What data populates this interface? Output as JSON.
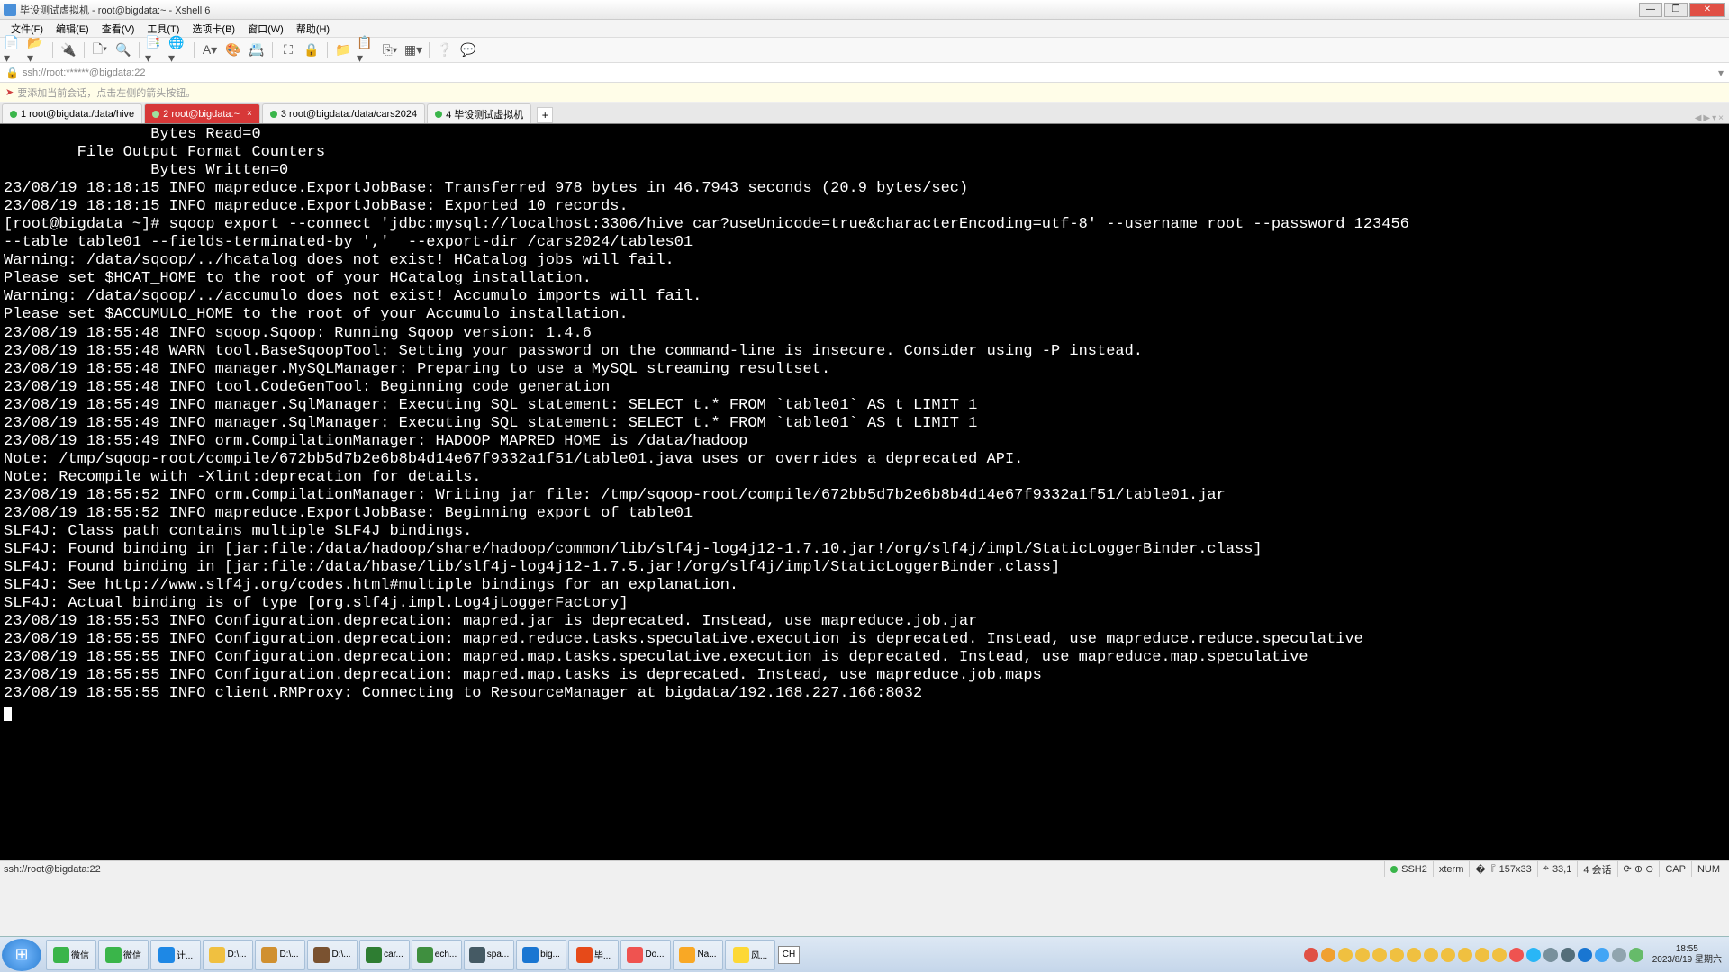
{
  "window": {
    "title": "毕设测试虚拟机 - root@bigdata:~ - Xshell 6"
  },
  "menus": [
    "文件(F)",
    "编辑(E)",
    "查看(V)",
    "工具(T)",
    "选项卡(B)",
    "窗口(W)",
    "帮助(H)"
  ],
  "address": "ssh://root:******@bigdata:22",
  "hint": "要添加当前会话，点击左侧的箭头按钮。",
  "tabs": [
    {
      "label": "1 root@bigdata:/data/hive"
    },
    {
      "label": "2 root@bigdata:~"
    },
    {
      "label": "3 root@bigdata:/data/cars2024"
    },
    {
      "label": "4 毕设测试虚拟机"
    }
  ],
  "terminal_lines": [
    "                Bytes Read=0",
    "        File Output Format Counters",
    "                Bytes Written=0",
    "23/08/19 18:18:15 INFO mapreduce.ExportJobBase: Transferred 978 bytes in 46.7943 seconds (20.9 bytes/sec)",
    "23/08/19 18:18:15 INFO mapreduce.ExportJobBase: Exported 10 records.",
    "[root@bigdata ~]# sqoop export --connect 'jdbc:mysql://localhost:3306/hive_car?useUnicode=true&characterEncoding=utf-8' --username root --password 123456  --table table01 --fields-terminated-by ','  --export-dir /cars2024/tables01",
    "Warning: /data/sqoop/../hcatalog does not exist! HCatalog jobs will fail.",
    "Please set $HCAT_HOME to the root of your HCatalog installation.",
    "Warning: /data/sqoop/../accumulo does not exist! Accumulo imports will fail.",
    "Please set $ACCUMULO_HOME to the root of your Accumulo installation.",
    "23/08/19 18:55:48 INFO sqoop.Sqoop: Running Sqoop version: 1.4.6",
    "23/08/19 18:55:48 WARN tool.BaseSqoopTool: Setting your password on the command-line is insecure. Consider using -P instead.",
    "23/08/19 18:55:48 INFO manager.MySQLManager: Preparing to use a MySQL streaming resultset.",
    "23/08/19 18:55:48 INFO tool.CodeGenTool: Beginning code generation",
    "23/08/19 18:55:49 INFO manager.SqlManager: Executing SQL statement: SELECT t.* FROM `table01` AS t LIMIT 1",
    "23/08/19 18:55:49 INFO manager.SqlManager: Executing SQL statement: SELECT t.* FROM `table01` AS t LIMIT 1",
    "23/08/19 18:55:49 INFO orm.CompilationManager: HADOOP_MAPRED_HOME is /data/hadoop",
    "Note: /tmp/sqoop-root/compile/672bb5d7b2e6b8b4d14e67f9332a1f51/table01.java uses or overrides a deprecated API.",
    "Note: Recompile with -Xlint:deprecation for details.",
    "23/08/19 18:55:52 INFO orm.CompilationManager: Writing jar file: /tmp/sqoop-root/compile/672bb5d7b2e6b8b4d14e67f9332a1f51/table01.jar",
    "23/08/19 18:55:52 INFO mapreduce.ExportJobBase: Beginning export of table01",
    "SLF4J: Class path contains multiple SLF4J bindings.",
    "SLF4J: Found binding in [jar:file:/data/hadoop/share/hadoop/common/lib/slf4j-log4j12-1.7.10.jar!/org/slf4j/impl/StaticLoggerBinder.class]",
    "SLF4J: Found binding in [jar:file:/data/hbase/lib/slf4j-log4j12-1.7.5.jar!/org/slf4j/impl/StaticLoggerBinder.class]",
    "SLF4J: See http://www.slf4j.org/codes.html#multiple_bindings for an explanation.",
    "SLF4J: Actual binding is of type [org.slf4j.impl.Log4jLoggerFactory]",
    "23/08/19 18:55:53 INFO Configuration.deprecation: mapred.jar is deprecated. Instead, use mapreduce.job.jar",
    "23/08/19 18:55:55 INFO Configuration.deprecation: mapred.reduce.tasks.speculative.execution is deprecated. Instead, use mapreduce.reduce.speculative",
    "23/08/19 18:55:55 INFO Configuration.deprecation: mapred.map.tasks.speculative.execution is deprecated. Instead, use mapreduce.map.speculative",
    "23/08/19 18:55:55 INFO Configuration.deprecation: mapred.map.tasks is deprecated. Instead, use mapreduce.job.maps",
    "23/08/19 18:55:55 INFO client.RMProxy: Connecting to ResourceManager at bigdata/192.168.227.166:8032"
  ],
  "status": {
    "left": "ssh://root@bigdata:22",
    "ssh": "SSH2",
    "term": "xterm",
    "size": "157x33",
    "pos": "33,1",
    "sessions": "4 会话",
    "cap": "CAP",
    "num": "NUM"
  },
  "taskbar": {
    "items": [
      {
        "label": "微信",
        "color": "#3ab54a"
      },
      {
        "label": "微信",
        "color": "#3ab54a"
      },
      {
        "label": "计...",
        "color": "#1e88e5"
      },
      {
        "label": "D:\\...",
        "color": "#f0c040"
      },
      {
        "label": "D:\\...",
        "color": "#d09030"
      },
      {
        "label": "D:\\...",
        "color": "#7a5230"
      },
      {
        "label": "car...",
        "color": "#2e7d32"
      },
      {
        "label": "ech...",
        "color": "#3f8f3f"
      },
      {
        "label": "spa...",
        "color": "#455a64"
      },
      {
        "label": "big...",
        "color": "#1976d2"
      },
      {
        "label": "毕...",
        "color": "#e64a19"
      },
      {
        "label": "Do...",
        "color": "#ef5350"
      },
      {
        "label": "Na...",
        "color": "#f9a825"
      },
      {
        "label": "风...",
        "color": "#fdd835"
      }
    ],
    "lang": "CH",
    "clock_time": "18:55",
    "clock_date": "2023/8/19 星期六"
  }
}
